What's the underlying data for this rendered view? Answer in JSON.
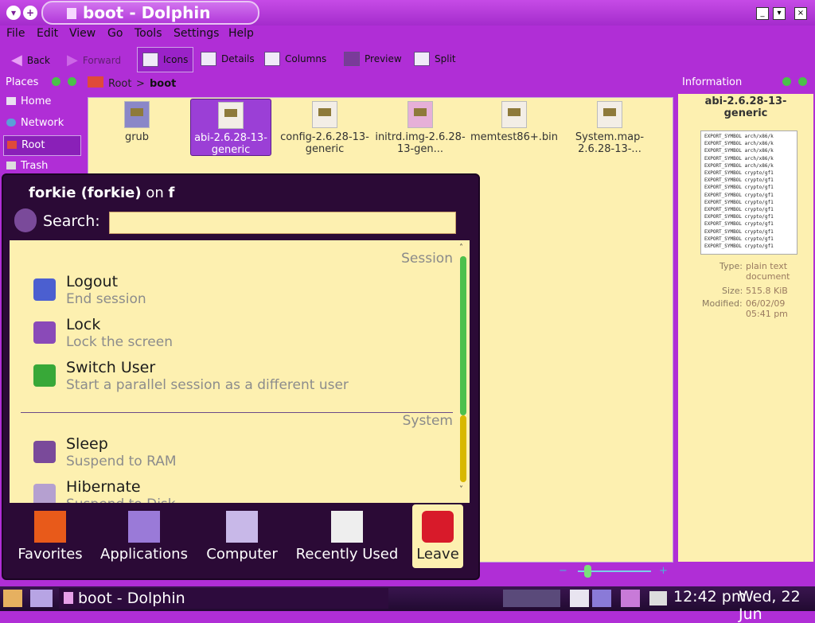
{
  "window": {
    "title": "boot - Dolphin"
  },
  "menubar": [
    "File",
    "Edit",
    "View",
    "Go",
    "Tools",
    "Settings",
    "Help"
  ],
  "toolbar": {
    "back": "Back",
    "forward": "Forward",
    "icons": "Icons",
    "details": "Details",
    "columns": "Columns",
    "preview": "Preview",
    "split": "Split"
  },
  "places": {
    "title": "Places",
    "items": [
      "Home",
      "Network",
      "Root",
      "Trash"
    ]
  },
  "breadcrumb": {
    "root": "Root",
    "current": "boot"
  },
  "files": [
    {
      "name": "grub"
    },
    {
      "name": "abi-2.6.28-13-generic"
    },
    {
      "name": "config-2.6.28-13-generic"
    },
    {
      "name": "initrd.img-2.6.28-13-gen..."
    },
    {
      "name": "memtest86+.bin"
    },
    {
      "name": "System.map-2.6.28-13-..."
    }
  ],
  "info": {
    "title": "Information",
    "filename": "abi-2.6.28-13-generic",
    "preview_lines": [
      "EXPORT_SYMBOL arch/x86/k",
      "EXPORT_SYMBOL arch/x86/k",
      "EXPORT_SYMBOL arch/x86/k",
      "EXPORT_SYMBOL arch/x86/k",
      "EXPORT_SYMBOL arch/x86/k",
      "EXPORT_SYMBOL crypto/gf1",
      "EXPORT_SYMBOL crypto/gf1",
      "EXPORT_SYMBOL crypto/gf1",
      "EXPORT_SYMBOL crypto/gf1",
      "EXPORT_SYMBOL crypto/gf1",
      "EXPORT_SYMBOL crypto/gf1",
      "EXPORT_SYMBOL crypto/gf1",
      "EXPORT_SYMBOL crypto/gf1",
      "EXPORT_SYMBOL crypto/gf1",
      "EXPORT_SYMBOL crypto/gf1",
      "EXPORT_SYMBOL crypto/gf1"
    ],
    "type_label": "Type:",
    "type_value": "plain text document",
    "size_label": "Size:",
    "size_value": "515.8 KiB",
    "modified_label": "Modified:",
    "modified_value": "06/02/09 05:41 pm"
  },
  "kickoff": {
    "user": "forkie (forkie)",
    "on": "on",
    "host": "f",
    "search_label": "Search:",
    "search_value": "",
    "sections": [
      {
        "title": "Session",
        "items": [
          {
            "title": "Logout",
            "sub": "End session",
            "icon": "logout-icon"
          },
          {
            "title": "Lock",
            "sub": "Lock the screen",
            "icon": "lock-icon"
          },
          {
            "title": "Switch User",
            "sub": "Start a parallel session as a different user",
            "icon": "switch-user-icon"
          }
        ]
      },
      {
        "title": "System",
        "items": [
          {
            "title": "Sleep",
            "sub": "Suspend to RAM",
            "icon": "sleep-icon"
          },
          {
            "title": "Hibernate",
            "sub": "Suspend to Disk",
            "icon": "hibernate-icon"
          }
        ]
      }
    ],
    "tabs": [
      "Favorites",
      "Applications",
      "Computer",
      "Recently Used",
      "Leave"
    ]
  },
  "taskbar": {
    "task": "boot - Dolphin",
    "clock": "12:42 pm",
    "date": "Wed, 22 Jun"
  },
  "colors": {
    "purple": "#b02ed6",
    "panel_cream": "#fdf0b0",
    "dark": "#2b0a36"
  }
}
